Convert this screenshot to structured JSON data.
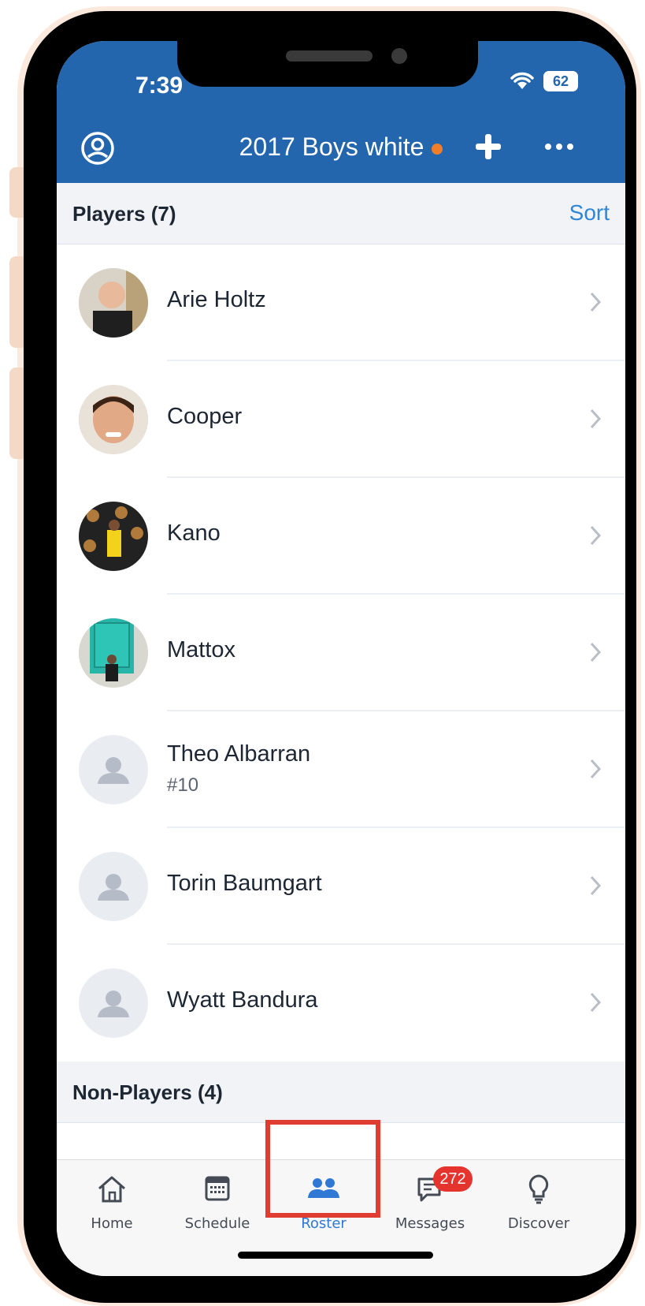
{
  "status_bar": {
    "time": "7:39",
    "battery": "62"
  },
  "header": {
    "team_name": "2017 Boys white"
  },
  "players_section": {
    "title": "Players (7)",
    "sort_label": "Sort",
    "players": [
      {
        "name": "Arie Holtz",
        "number": ""
      },
      {
        "name": "Cooper",
        "number": ""
      },
      {
        "name": "Kano",
        "number": ""
      },
      {
        "name": "Mattox",
        "number": ""
      },
      {
        "name": "Theo Albarran",
        "number": "#10"
      },
      {
        "name": "Torin Baumgart",
        "number": ""
      },
      {
        "name": "Wyatt Bandura",
        "number": ""
      }
    ]
  },
  "non_players_section": {
    "title": "Non-Players (4)"
  },
  "tabbar": {
    "tabs": [
      {
        "label": "Home",
        "icon": "home-icon"
      },
      {
        "label": "Schedule",
        "icon": "calendar-icon"
      },
      {
        "label": "Roster",
        "icon": "people-icon",
        "active": true
      },
      {
        "label": "Messages",
        "icon": "chat-icon",
        "badge": "272"
      },
      {
        "label": "Discover",
        "icon": "lightbulb-icon"
      }
    ]
  },
  "colors": {
    "header_blue": "#2366ad",
    "accent_blue": "#2f78d4",
    "badge_red": "#e5342e",
    "status_dot": "#f07d2a",
    "highlight": "#e03d32"
  }
}
